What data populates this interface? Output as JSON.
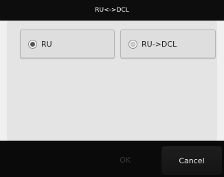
{
  "dialog": {
    "title": "RU<->DCL",
    "options": [
      {
        "label": "RU",
        "selected": true
      },
      {
        "label": "RU->DCL",
        "selected": false
      }
    ],
    "buttons": {
      "ok_label": "OK",
      "cancel_label": "Cancel"
    }
  },
  "colors": {
    "titlebar_bg": "#0d0d0d",
    "content_bg": "#e4e4e4",
    "footer_bg": "#0a0a0a"
  }
}
